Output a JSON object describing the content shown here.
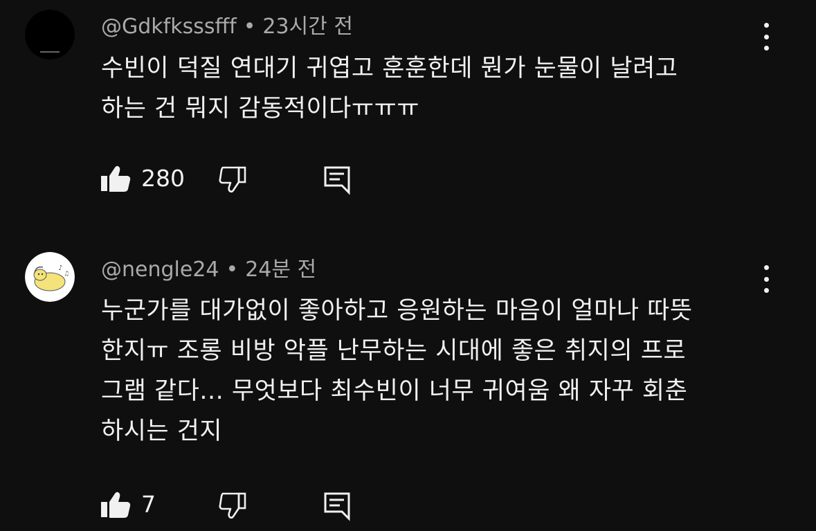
{
  "comments": [
    {
      "author": "@Gdkfksssfff",
      "separator": "•",
      "time": "23시간 전",
      "lines": [
        "수빈이 덕질 연대기 귀엽고 훈훈한데 뭔가 눈물이 날려고",
        "하는 건 뭐지 감동적이다ㅠㅠㅠ"
      ],
      "likes": "280",
      "avatar_icon": "black-circle-avatar"
    },
    {
      "author": "@nengle24",
      "separator": "•",
      "time": "24분 전",
      "lines": [
        "누군가를 대가없이 좋아하고 응원하는 마음이 얼마나 따뜻",
        "한지ㅠ 조롱 비방 악플 난무하는 시대에 좋은 취지의 프로",
        "그램 같다... 무엇보다 최수빈이 너무 귀여움 왜 자꾸 회춘",
        "하시는 건지"
      ],
      "likes": "7",
      "avatar_icon": "hamster-avatar"
    }
  ],
  "icons": {
    "like": "thumbs-up-icon",
    "dislike": "thumbs-down-icon",
    "reply": "reply-comment-icon",
    "menu": "more-vertical-icon"
  },
  "colors": {
    "background": "#0f0f0f",
    "text_primary": "#f1f1f1",
    "text_secondary": "#aaaaaa"
  }
}
